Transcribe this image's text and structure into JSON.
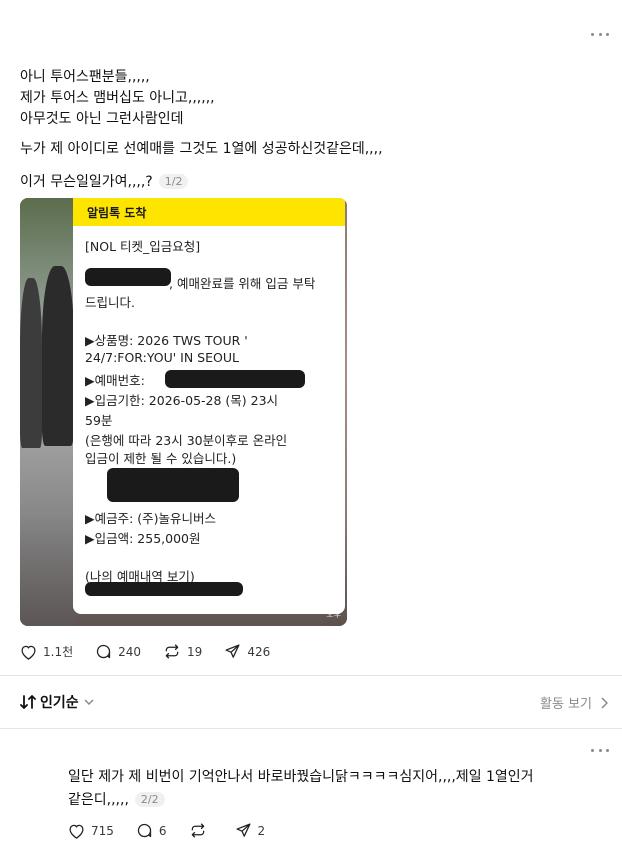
{
  "post": {
    "lines": [
      "아니 투어스팬분들,,,,,",
      "제가 투어스 맴버십도 아니고,,,,,,",
      "아무것도 아닌 그런사람인데",
      "누가 제 아이디로 선예매를 그것도 1열에 성공하신것같은데,,,,",
      "이거 무슨일일가여,,,,?"
    ],
    "page_badge": "1/2",
    "notice": {
      "header": "알림톡 도착",
      "lines": [
        "[NOL 티켓_입금요청]",
        ", 예매완료를 위해 입금 부탁",
        "드립니다.",
        "▶상품명: 2026 TWS TOUR '",
        "24/7:FOR:YOU' IN SEOUL",
        "▶예매번호:",
        "▶입금기한: 2026-05-28 (목) 23시",
        "59분",
        "(은행에 따라 23시 30분이후로 온라인",
        "입금이 제한 될 수 있습니다.)",
        "▶예금주: (주)놀유니버스",
        "▶입금액: 255,000원",
        "(나의 예매내역 보기)"
      ]
    },
    "photo_credit": "오후",
    "stats": {
      "likes": "1.1천",
      "comments": "240",
      "reposts": "19",
      "shares": "426"
    }
  },
  "sort": {
    "label": "인기순"
  },
  "activity": {
    "label": "활동 보기"
  },
  "reply": {
    "lines": [
      "일단 제가 제 비번이 기억안나서 바로바꿨습니닭ㅋㅋㅋㅋ심지어,,,,제일 1열인거",
      "같은디,,,,,"
    ],
    "page_badge": "2/2",
    "stats": {
      "likes": "715",
      "comments": "6",
      "shares": "2"
    }
  }
}
